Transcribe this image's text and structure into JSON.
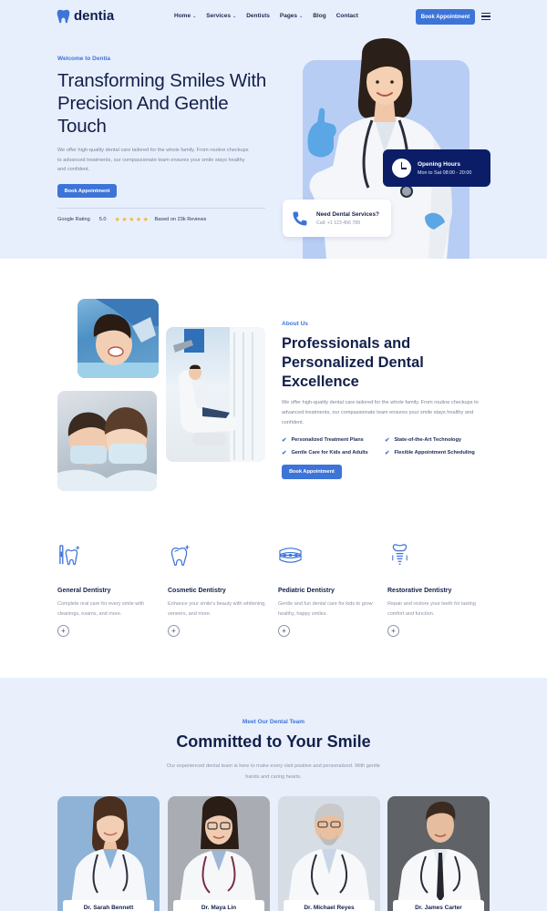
{
  "brand": {
    "name": "dentia",
    "accent": "#3d74d7",
    "navy": "#0c1d67"
  },
  "nav": {
    "items": [
      {
        "label": "Home",
        "dropdown": true
      },
      {
        "label": "Services",
        "dropdown": true
      },
      {
        "label": "Dentists",
        "dropdown": false
      },
      {
        "label": "Pages",
        "dropdown": true
      },
      {
        "label": "Blog",
        "dropdown": false
      },
      {
        "label": "Contact",
        "dropdown": false
      }
    ],
    "cta": "Book Appointment"
  },
  "hero": {
    "eyebrow": "Welcome to Dentia",
    "title": "Transforming Smiles With Precision And Gentle Touch",
    "description": "We offer high-quality dental care tailored for the whole family. From routine checkups to advanced treatments, our compassionate team ensures your smile stays healthy and confident.",
    "button": "Book Appointment",
    "rating_label": "Google Rating",
    "rating_value": "5.0",
    "stars": 5,
    "stars_text": "★★★★★",
    "reviews": "Based on 23k Reviews",
    "hours_title": "Opening Hours",
    "hours_time": "Mon to Sat 08:00 - 20:00",
    "call_title": "Need Dental Services?",
    "call_number": "Call: +1 123 456 789"
  },
  "about": {
    "eyebrow": "About Us",
    "title": "Professionals and Personalized Dental Excellence",
    "description": "We offer high-quality dental care tailored for the whole family. From routine checkups to advanced treatments, our compassionate team ensures your smile stays healthy and confident.",
    "features": [
      "Personalized Treatment Plans",
      "State-of-the-Art Technology",
      "Gentle Care for Kids and Adults",
      "Flexible Appointment Scheduling"
    ],
    "button": "Book Appointment"
  },
  "services": [
    {
      "icon": "tooth-brush-icon",
      "title": "General Dentistry",
      "description": "Complete oral care for every smile with cleanings, exams, and more."
    },
    {
      "icon": "sparkle-tooth-icon",
      "title": "Cosmetic Dentistry",
      "description": "Enhance your smile's beauty with whitening, veneers, and more."
    },
    {
      "icon": "braces-icon",
      "title": "Pediatric Dentistry",
      "description": "Gentle and fun dental care for kids to grow healthy, happy smiles."
    },
    {
      "icon": "implant-icon",
      "title": "Restorative Dentistry",
      "description": "Repair and restore your teeth for lasting comfort and function."
    }
  ],
  "team": {
    "eyebrow": "Meet Our Dental Team",
    "title": "Committed to Your Smile",
    "description": "Our experienced dental team is here to make every visit positive and personalized. With gentle hands and caring hearts.",
    "members": [
      {
        "name": "Dr. Sarah Bennett"
      },
      {
        "name": "Dr. Maya Lin"
      },
      {
        "name": "Dr. Michael Reyes"
      },
      {
        "name": "Dr. James Carter"
      }
    ]
  }
}
